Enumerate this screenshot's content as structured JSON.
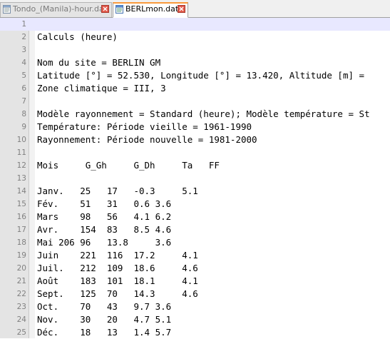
{
  "tabs": [
    {
      "label": "Tondo_(Manila)-hour.dat",
      "active": false
    },
    {
      "label": "BERLmon.dat",
      "active": true
    }
  ],
  "colors": {
    "accent_tab": "#fa9a3c",
    "current_line": "#e8e8ff",
    "close_button": "#e25a4c"
  },
  "editor": {
    "lines": [
      {
        "n": "1",
        "text": ""
      },
      {
        "n": "2",
        "text": "Calculs (heure)"
      },
      {
        "n": "3",
        "text": ""
      },
      {
        "n": "4",
        "text": "Nom du site = BERLIN GM"
      },
      {
        "n": "5",
        "text": "Latitude [°] = 52.530, Longitude [°] = 13.420, Altitude [m] ="
      },
      {
        "n": "6",
        "text": "Zone climatique = III, 3"
      },
      {
        "n": "7",
        "text": ""
      },
      {
        "n": "8",
        "text": "Modèle rayonnement = Standard (heure); Modèle température = St"
      },
      {
        "n": "9",
        "text": "Température: Période vieille = 1961-1990"
      },
      {
        "n": "10",
        "text": "Rayonnement: Période nouvelle = 1981-2000"
      },
      {
        "n": "11",
        "text": ""
      },
      {
        "n": "12",
        "text": "Mois     G_Gh     G_Dh     Ta   FF"
      },
      {
        "n": "13",
        "text": ""
      },
      {
        "n": "14",
        "text": "Janv.   25   17   -0.3     5.1"
      },
      {
        "n": "15",
        "text": "Fév.    51   31   0.6 3.6"
      },
      {
        "n": "16",
        "text": "Mars    98   56   4.1 6.2"
      },
      {
        "n": "17",
        "text": "Avr.    154  83   8.5 4.6"
      },
      {
        "n": "18",
        "text": "Mai 206 96   13.8     3.6"
      },
      {
        "n": "19",
        "text": "Juin    221  116  17.2     4.1"
      },
      {
        "n": "20",
        "text": "Juil.   212  109  18.6     4.6"
      },
      {
        "n": "21",
        "text": "Août    183  101  18.1     4.1"
      },
      {
        "n": "22",
        "text": "Sept.   125  70   14.3     4.6"
      },
      {
        "n": "23",
        "text": "Oct.    70   43   9.7 3.6"
      },
      {
        "n": "24",
        "text": "Nov.    30   20   4.7 5.1"
      },
      {
        "n": "25",
        "text": "Déc.    18   13   1.4 5.7"
      }
    ]
  },
  "icons": {
    "tab_file": "notepad-file-icon",
    "tab_close": "close-icon"
  }
}
